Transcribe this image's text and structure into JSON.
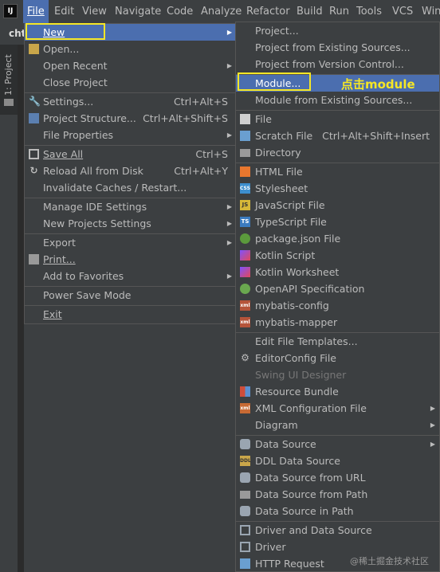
{
  "app_icon": "IJ",
  "menubar": [
    "File",
    "Edit",
    "View",
    "Navigate",
    "Code",
    "Analyze",
    "Refactor",
    "Build",
    "Run",
    "Tools",
    "VCS",
    "Win"
  ],
  "tab_stub": "cht",
  "side_tab": "1: Project",
  "file_menu": {
    "new": "New",
    "open": "Open...",
    "open_recent": "Open Recent",
    "close_project": "Close Project",
    "settings": "Settings...",
    "settings_sc": "Ctrl+Alt+S",
    "project_structure": "Project Structure...",
    "project_structure_sc": "Ctrl+Alt+Shift+S",
    "file_properties": "File Properties",
    "save_all": "Save All",
    "save_all_sc": "Ctrl+S",
    "reload": "Reload All from Disk",
    "reload_sc": "Ctrl+Alt+Y",
    "invalidate": "Invalidate Caches / Restart...",
    "manage_ide": "Manage IDE Settings",
    "new_projects_settings": "New Projects Settings",
    "export": "Export",
    "print": "Print...",
    "add_favorites": "Add to Favorites",
    "power_save": "Power Save Mode",
    "exit": "Exit"
  },
  "new_menu": {
    "project": "Project...",
    "project_existing": "Project from Existing Sources...",
    "project_vcs": "Project from Version Control...",
    "module": "Module...",
    "module_existing": "Module from Existing Sources...",
    "file": "File",
    "scratch_file": "Scratch File",
    "scratch_file_sc": "Ctrl+Alt+Shift+Insert",
    "directory": "Directory",
    "html_file": "HTML File",
    "stylesheet": "Stylesheet",
    "js_file": "JavaScript File",
    "ts_file": "TypeScript File",
    "package_json": "package.json File",
    "kotlin_script": "Kotlin Script",
    "kotlin_worksheet": "Kotlin Worksheet",
    "openapi": "OpenAPI Specification",
    "mybatis_config": "mybatis-config",
    "mybatis_mapper": "mybatis-mapper",
    "edit_templates": "Edit File Templates...",
    "editorconfig": "EditorConfig File",
    "swing_ui": "Swing UI Designer",
    "resource_bundle": "Resource Bundle",
    "xml_config": "XML Configuration File",
    "diagram": "Diagram",
    "data_source": "Data Source",
    "ddl_data_source": "DDL Data Source",
    "ds_url": "Data Source from URL",
    "ds_path": "Data Source from Path",
    "ds_in_path": "Data Source in Path",
    "driver_ds": "Driver and Data Source",
    "driver": "Driver",
    "http_request": "HTTP Request"
  },
  "annotation": "点击module",
  "watermark": "@稀土掘金技术社区",
  "colors": {
    "selection": "#4b6eaf",
    "highlight": "#f5e625",
    "menu_bg": "#3c3f41"
  }
}
